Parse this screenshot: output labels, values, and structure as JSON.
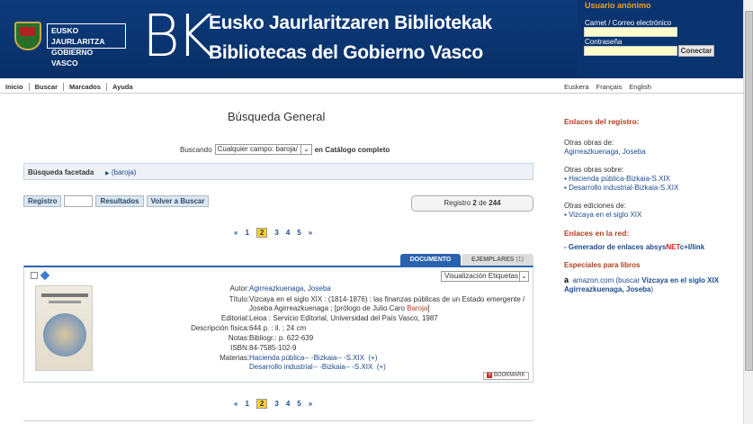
{
  "header": {
    "logo_line1": "EUSKO JAURLARITZA",
    "logo_line2": "GOBIERNO VASCO",
    "bk": "BK",
    "title1": "Eusko Jaurlaritzaren Bibliotekak",
    "title2": "Bibliotecas del Gobierno Vasco"
  },
  "login": {
    "anon": "Usuario anónimo",
    "card_label": "Carnet / Correo electrónico",
    "pass_label": "Contraseña",
    "button": "Conectar"
  },
  "nav": {
    "items": [
      "Inicio",
      "Buscar",
      "Marcados",
      "Ayuda"
    ],
    "langs": [
      "Euskera",
      "Français",
      "English"
    ]
  },
  "search": {
    "title": "Búsqueda General",
    "searching": "Buscando",
    "select": "Cualquier campo: baroja/",
    "catalog": "en Catálogo completo",
    "facet_label": "Búsqueda facetada",
    "facet_link": "(baroja)"
  },
  "buttons": {
    "registro": "Registro",
    "resultados": "Resultados",
    "volver": "Volver a Buscar"
  },
  "record_counter": {
    "prefix": "Registro",
    "current": "2",
    "of": "de",
    "total": "244"
  },
  "pager": {
    "prev": "«",
    "pages": [
      "1",
      "2",
      "3",
      "4",
      "5"
    ],
    "current": "2",
    "next": "»"
  },
  "tabs": {
    "documento": "DOCUMENTO",
    "ejemplares": "EJEMPLARES",
    "ejemplares_count": "(1)"
  },
  "record": {
    "viz": "Visualización Etiquetas",
    "autor_k": "Autor:",
    "autor_v": "Agirreazkuenaga, Joseba",
    "titulo_k": "Título:",
    "titulo_v": "Vizcaya en el siglo XIX : (1814-1876) : las finanzas públicas de un Estado emergente / Joseba Agirreazkuenaga ; [prólogo de Julio Caro ",
    "titulo_v2": "Baroja",
    "titulo_v3": "]",
    "editorial_k": "Editorial:",
    "editorial_v": "Leioa : Servicio Editorial, Universidad del País Vasco, 1987",
    "desc_k": "Descripción física:",
    "desc_v": "644 p. : il. ; 24 cm",
    "notas_k": "Notas:",
    "notas_v": "Bibliogr.: p. 622-639",
    "isbn_k": "ISBN:",
    "isbn_v": "84-7585-102-9",
    "materias_k": "Materias:",
    "materia1": "Hacienda pública-- -Bizkaia-- -S.XIX",
    "materia2": "Desarrollo industrial-- -Bizkaia-- -S.XIX",
    "plus": "(+)",
    "bookmark": "BOOKMARK"
  },
  "side": {
    "h_registro": "Enlaces del registro:",
    "otras_de": "Otras obras de:",
    "otras_de_link": "Agirreazkuenaga, Joseba",
    "otras_sobre": "Otras obras sobre:",
    "sobre1": "Hacienda pública-Bizkaia-S.XIX",
    "sobre2": "Desarrollo industrial-Bizkaia-S.XIX",
    "otras_ed": "Otras ediciones de:",
    "ed1": "Vizcaya en el siglo XIX",
    "h_red": "Enlaces en la red:",
    "gen_prefix": "- Generador de enlaces absys",
    "gen_net": "NET",
    "gen_suffix": "c+I/link",
    "h_libros": "Especiales para libros",
    "amazon": "amazon.com (buscar ",
    "amazon_bold": "Vizcaya en el siglo XIX Agirreazkuenaga, Joseba",
    "amazon_end": ")"
  }
}
